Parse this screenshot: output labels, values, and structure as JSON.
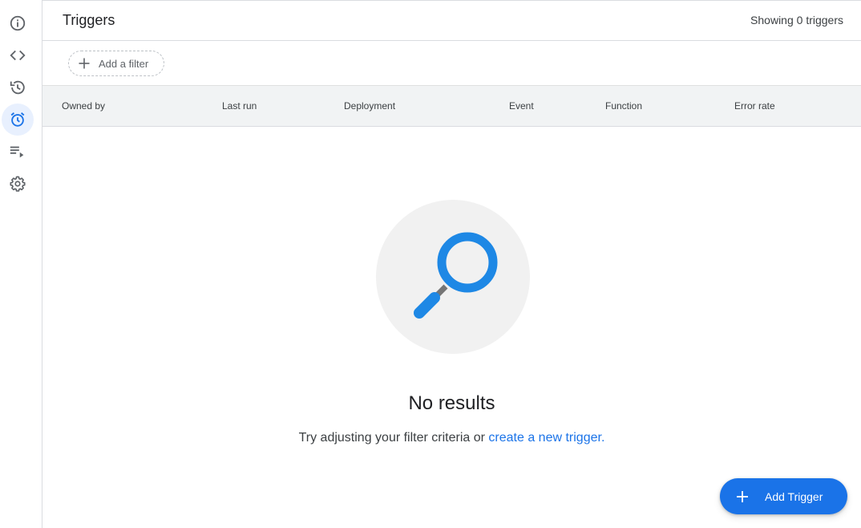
{
  "sidebar": {
    "items": [
      {
        "icon": "info-icon",
        "active": false
      },
      {
        "icon": "code-icon",
        "active": false
      },
      {
        "icon": "history-icon",
        "active": false
      },
      {
        "icon": "alarm-clock-icon",
        "active": true
      },
      {
        "icon": "playlist-play-icon",
        "active": false
      },
      {
        "icon": "gear-icon",
        "active": false
      }
    ]
  },
  "header": {
    "title": "Triggers",
    "count_text": "Showing 0 triggers"
  },
  "filter": {
    "add_label": "Add a filter"
  },
  "table": {
    "columns": [
      "Owned by",
      "Last run",
      "Deployment",
      "Event",
      "Function",
      "Error rate"
    ]
  },
  "empty_state": {
    "icon": "magnifier-icon",
    "title": "No results",
    "message": "Try adjusting your filter criteria or",
    "link": "create a new trigger."
  },
  "fab": {
    "label": "Add Trigger"
  },
  "colors": {
    "accent": "#1a73e8",
    "active_bg": "#e8f0fe",
    "icon": "#5f6368"
  }
}
